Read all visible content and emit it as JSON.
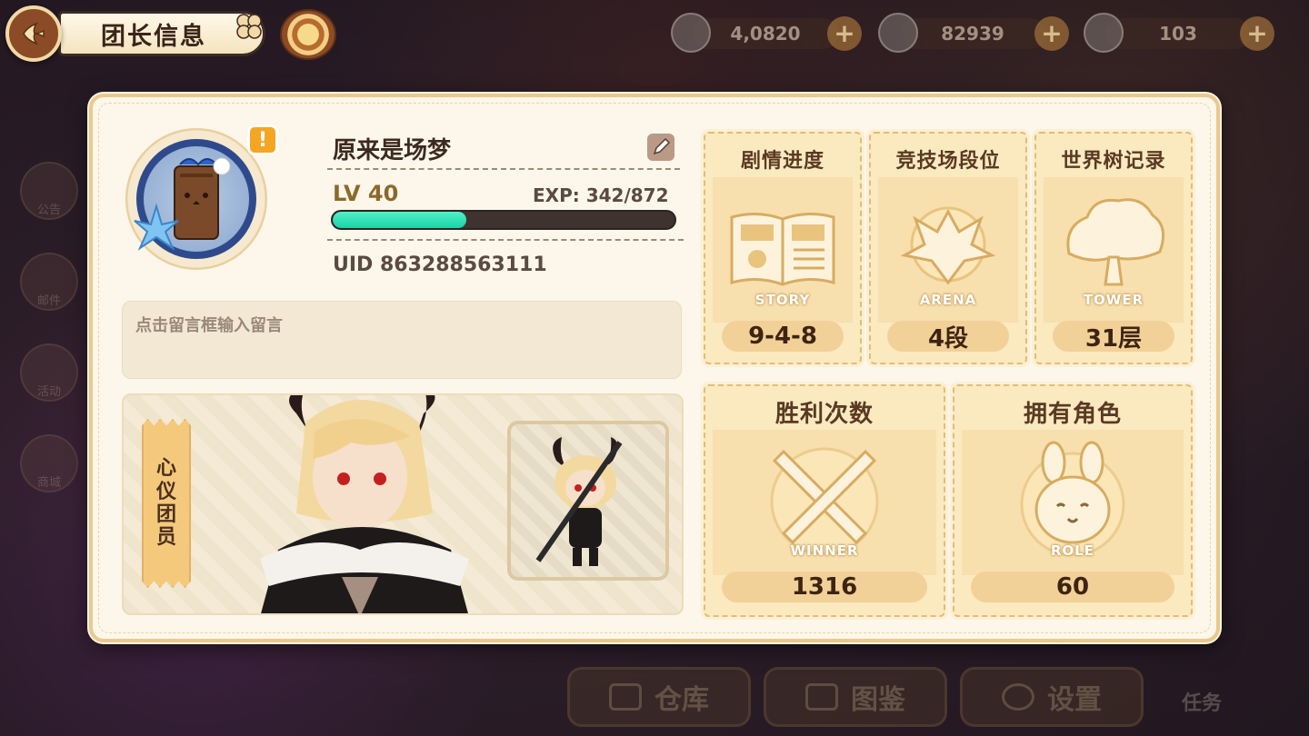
{
  "topbar": {
    "title": "团长信息",
    "resources": [
      {
        "value": "4,0820",
        "icon": "stamina-icon"
      },
      {
        "value": "82939",
        "icon": "coin-icon"
      },
      {
        "value": "103",
        "icon": "carrot-icon"
      }
    ],
    "plus_label": "+"
  },
  "profile": {
    "name": "原来是场梦",
    "level": "LV 40",
    "exp": "EXP: 342/872",
    "exp_fraction": 0.39,
    "uid": "UID 863288563111",
    "alert": "!"
  },
  "message": {
    "placeholder": "点击留言框输入留言"
  },
  "favorite": {
    "label_chars": [
      "心",
      "仪",
      "团",
      "员"
    ]
  },
  "stats": {
    "story": {
      "title": "剧情进度",
      "caption": "STORY",
      "value": "9-4-8"
    },
    "arena": {
      "title": "竞技场段位",
      "caption": "ARENA",
      "value": "4段"
    },
    "tower": {
      "title": "世界树记录",
      "caption": "TOWER",
      "value": "31层"
    },
    "wins": {
      "title": "胜利次数",
      "caption": "WINNER",
      "value": "1316"
    },
    "roles": {
      "title": "拥有角色",
      "caption": "ROLE",
      "value": "60"
    }
  },
  "background": {
    "side_buttons": [
      "公告",
      "邮件",
      "活动",
      "商城"
    ],
    "bottom_buttons": [
      "仓库",
      "图鉴",
      "设置"
    ],
    "task_label": "任务"
  },
  "colors": {
    "panel_bg": "#fdf6ea",
    "card_bg": "#fbe9c0",
    "exp_fill": "#19d4a6",
    "avatar_ring": "#2f4a8c"
  }
}
